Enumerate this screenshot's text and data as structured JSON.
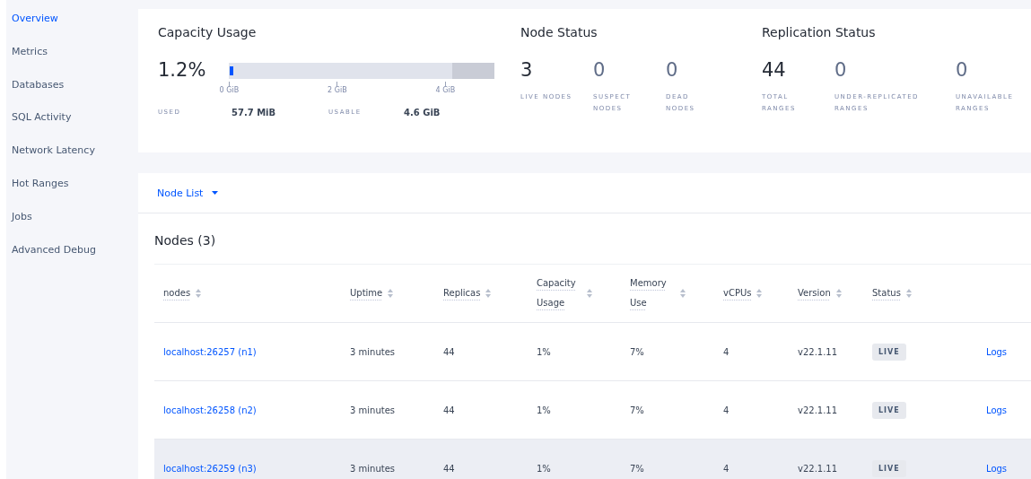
{
  "sidebar": {
    "items": [
      {
        "label": "Overview",
        "selected": true
      },
      {
        "label": "Metrics",
        "selected": false
      },
      {
        "label": "Databases",
        "selected": false
      },
      {
        "label": "SQL Activity",
        "selected": false
      },
      {
        "label": "Network Latency",
        "selected": false
      },
      {
        "label": "Hot Ranges",
        "selected": false
      },
      {
        "label": "Jobs",
        "selected": false
      },
      {
        "label": "Advanced Debug",
        "selected": false
      }
    ]
  },
  "capacity": {
    "title": "Capacity Usage",
    "percent": "1.2%",
    "level": 0.012,
    "ticks": [
      "0 GiB",
      "2 GiB",
      "4 GiB"
    ],
    "stats": [
      {
        "label": "USED",
        "value": "57.7 MiB"
      },
      {
        "label": "USABLE",
        "value": "4.6 GiB"
      }
    ]
  },
  "node_status": {
    "title": "Node Status",
    "metrics": [
      {
        "value": "3",
        "label": "LIVE NODES"
      },
      {
        "value": "0",
        "label": "SUSPECT NODES"
      },
      {
        "value": "0",
        "label": "DEAD NODES"
      }
    ]
  },
  "replication_status": {
    "title": "Replication Status",
    "metrics": [
      {
        "value": "44",
        "label": "TOTAL RANGES"
      },
      {
        "value": "0",
        "label": "UNDER-REPLICATED RANGES"
      },
      {
        "value": "0",
        "label": "UNAVAILABLE RANGES"
      }
    ]
  },
  "view_selector": "Node List",
  "table": {
    "title": "Nodes (3)",
    "columns": [
      "nodes",
      "Uptime",
      "Replicas",
      "Capacity Usage",
      "Memory Use",
      "vCPUs",
      "Version",
      "Status"
    ],
    "rows": [
      {
        "node": "localhost:26257 (n1)",
        "uptime": "3 minutes",
        "replicas": "44",
        "capacity": "1%",
        "memory": "7%",
        "vcpus": "4",
        "version": "v22.1.11",
        "status": "LIVE",
        "logs": "Logs",
        "highlighted": false
      },
      {
        "node": "localhost:26258 (n2)",
        "uptime": "3 minutes",
        "replicas": "44",
        "capacity": "1%",
        "memory": "7%",
        "vcpus": "4",
        "version": "v22.1.11",
        "status": "LIVE",
        "logs": "Logs",
        "highlighted": false
      },
      {
        "node": "localhost:26259 (n3)",
        "uptime": "3 minutes",
        "replicas": "44",
        "capacity": "1%",
        "memory": "7%",
        "vcpus": "4",
        "version": "v22.1.11",
        "status": "LIVE",
        "logs": "Logs",
        "highlighted": true
      }
    ]
  }
}
